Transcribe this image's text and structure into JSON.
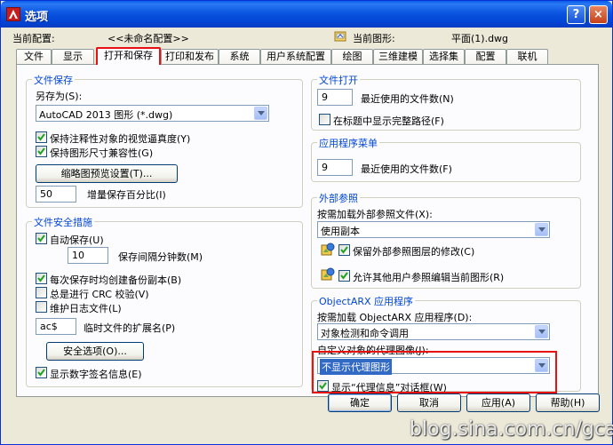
{
  "window": {
    "title": "选项",
    "help_glyph": "?",
    "close_glyph": "×"
  },
  "info": {
    "current_profile_label": "当前配置:",
    "current_profile_value": "<<未命名配置>>",
    "current_drawing_label": "当前图形:",
    "current_drawing_value": "平面(1).dwg"
  },
  "tabs": [
    {
      "label": "文件"
    },
    {
      "label": "显示"
    },
    {
      "label": "打开和保存",
      "active": true
    },
    {
      "label": "打印和发布"
    },
    {
      "label": "系统"
    },
    {
      "label": "用户系统配置"
    },
    {
      "label": "绘图"
    },
    {
      "label": "三维建模"
    },
    {
      "label": "选择集"
    },
    {
      "label": "配置"
    },
    {
      "label": "联机"
    }
  ],
  "file_save": {
    "title": "文件保存",
    "save_as_label": "另存为(S):",
    "save_as_value": "AutoCAD 2013 图形 (*.dwg)",
    "keep_annotative_label": "保持注释性对象的视觉逼真度(Y)",
    "keep_annotative_checked": true,
    "keep_size_compat_label": "保持图形尺寸兼容性(G)",
    "keep_size_compat_checked": true,
    "thumbnail_button": "缩略图预览设置(T)...",
    "incremental_value": "50",
    "incremental_label": "增量保存百分比(I)"
  },
  "file_safety": {
    "title": "文件安全措施",
    "autosave_label": "自动保存(U)",
    "autosave_checked": true,
    "interval_value": "10",
    "interval_label": "保存间隔分钟数(M)",
    "backup_label": "每次保存时均创建备份副本(B)",
    "backup_checked": true,
    "crc_label": "总是进行 CRC 校验(V)",
    "crc_checked": false,
    "log_label": "维护日志文件(L)",
    "log_checked": false,
    "temp_ext_value": "ac$",
    "temp_ext_label": "临时文件的扩展名(P)",
    "security_button": "安全选项(O)...",
    "digital_sig_label": "显示数字签名信息(E)",
    "digital_sig_checked": true
  },
  "file_open": {
    "title": "文件打开",
    "recent_value": "9",
    "recent_label": "最近使用的文件数(N)",
    "full_path_label": "在标题中显示完整路径(F)",
    "full_path_checked": false
  },
  "app_menu": {
    "title": "应用程序菜单",
    "recent_value": "9",
    "recent_label": "最近使用的文件数(F)"
  },
  "xref": {
    "title": "外部参照",
    "demand_label": "按需加载外部参照文件(X):",
    "demand_value": "使用副本",
    "retain_changes_label": "保留外部参照图层的修改(C)",
    "retain_changes_checked": true,
    "allow_edit_label": "允许其他用户参照编辑当前图形(R)",
    "allow_edit_checked": true
  },
  "objectarx": {
    "title": "ObjectARX 应用程序",
    "demand_label": "按需加载 ObjectARX 应用程序(D):",
    "demand_value": "对象检测和命令调用",
    "proxy_label": "自定义对象的代理图像(J):",
    "proxy_value": "不显示代理图形",
    "proxy_dialog_label": "显示“代理信息”对话框(W)",
    "proxy_dialog_checked": true
  },
  "footer": {
    "ok": "确定",
    "cancel": "取消",
    "apply": "应用(A)",
    "help": "帮助(H)"
  },
  "watermark": "blog.sina.com.cn/gcad",
  "colors": {
    "titlebar": "#0044d4",
    "group_title": "#0046d5",
    "highlight_box": "#e81010",
    "selection": "#316ac5"
  }
}
